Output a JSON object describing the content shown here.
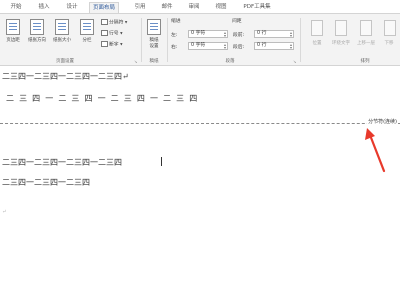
{
  "ribbon": {
    "tabs": [
      {
        "label": "开始"
      },
      {
        "label": "插入"
      },
      {
        "label": "设计"
      },
      {
        "label": "页面布局"
      },
      {
        "label": "引用"
      },
      {
        "label": "邮件"
      },
      {
        "label": "审阅"
      },
      {
        "label": "视图"
      },
      {
        "label": "PDF工具集"
      }
    ],
    "active_tab": "页面布局",
    "page_setup": {
      "margins": "页边距",
      "orientation": "纸张方向",
      "size": "纸张大小",
      "columns": "分栏",
      "breaks": "分隔符",
      "line_numbers": "行号",
      "hyphenation": "断字",
      "group_label": "页面设置"
    },
    "draft": {
      "label_line1": "稿纸",
      "label_line2": "设置",
      "group_label": "稿纸"
    },
    "paragraph": {
      "indent_header": "缩进",
      "spacing_header": "间距",
      "left_label": "左:",
      "left_value": "0 字符",
      "right_label": "右:",
      "right_value": "0 字符",
      "before_label": "段前:",
      "before_value": "0 行",
      "after_label": "段后:",
      "after_value": "0 行",
      "group_label": "段落"
    },
    "arrange": {
      "position": "位置",
      "wrap_text": "环绕文字",
      "bring_forward": "上移一层",
      "send_backward": "下移",
      "group_label": "排列"
    }
  },
  "document": {
    "lines": [
      "二三四一二三四一二三四一二三四↵",
      "二  三  四  一  二  三  四  一  二  三  四  一  二  三  四",
      "二三四一二三四一二三四一二三四",
      "二三四一二三四一二三四"
    ],
    "section_break_label": "分节符(连续)"
  }
}
